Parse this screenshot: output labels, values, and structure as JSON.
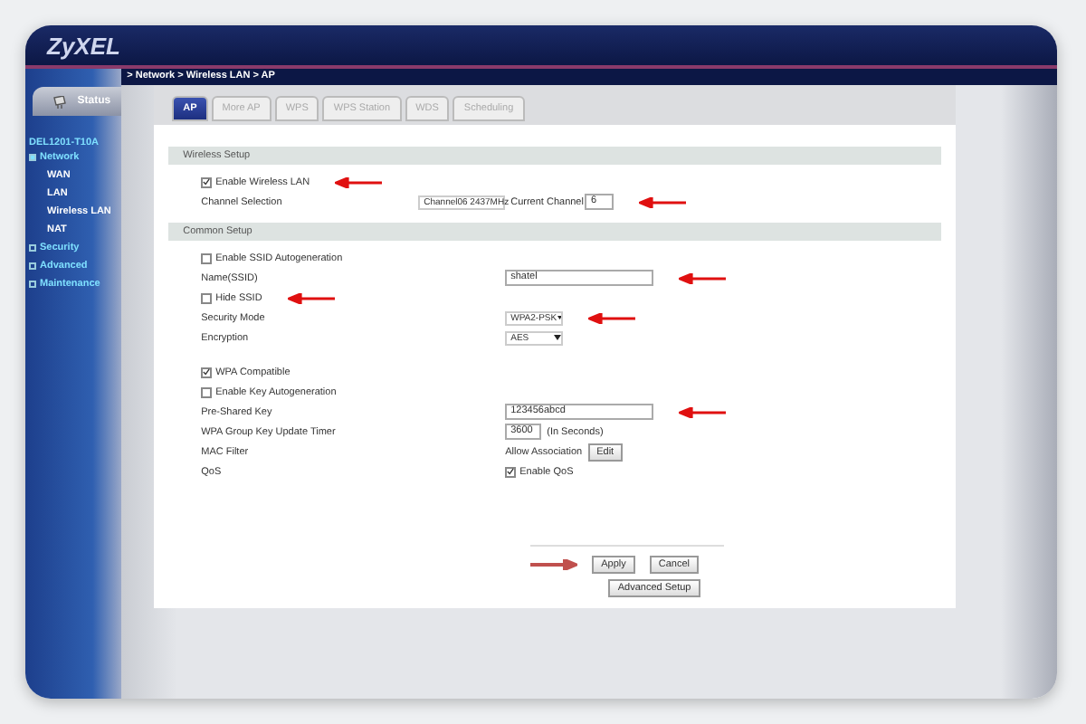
{
  "header": {
    "logo": "ZyXEL"
  },
  "sidebar": {
    "status_button": "Status",
    "device": "DEL1201-T10A",
    "items": [
      {
        "label": "Network",
        "expanded": true,
        "children": [
          {
            "label": "WAN"
          },
          {
            "label": "LAN"
          },
          {
            "label": "Wireless LAN"
          },
          {
            "label": "NAT"
          }
        ]
      },
      {
        "label": "Security",
        "expanded": false
      },
      {
        "label": "Advanced",
        "expanded": false
      },
      {
        "label": "Maintenance",
        "expanded": false
      }
    ]
  },
  "breadcrumb": "> Network > Wireless LAN > AP",
  "tabs": [
    {
      "label": "AP",
      "selected": true
    },
    {
      "label": "More AP",
      "selected": false
    },
    {
      "label": "WPS",
      "selected": false
    },
    {
      "label": "WPS Station",
      "selected": false
    },
    {
      "label": "WDS",
      "selected": false
    },
    {
      "label": "Scheduling",
      "selected": false
    }
  ],
  "wireless_setup": {
    "title": "Wireless Setup",
    "enable": {
      "label": "Enable Wireless LAN",
      "checked": true,
      "arrow": true
    },
    "channel": {
      "label": "Channel Selection",
      "select": "Channel06 2437MHz",
      "current_label": "Current Channel",
      "current_value": "6",
      "arrow": true
    }
  },
  "common_setup": {
    "title": "Common Setup",
    "rows": [
      {
        "kind": "checkbox",
        "label": "Enable SSID Autogeneration",
        "checked": false,
        "arrow": false
      },
      {
        "kind": "field",
        "label": "Name(SSID)",
        "value": "shatel",
        "arrow": true
      },
      {
        "kind": "checkbox",
        "label": "Hide SSID",
        "checked": false,
        "arrow": true
      },
      {
        "kind": "select",
        "label": "Security Mode",
        "value": "WPA2-PSK",
        "arrow": true
      },
      {
        "kind": "select",
        "label": "Encryption",
        "value": "AES",
        "arrow": false
      },
      {
        "kind": "checkbox",
        "label": "WPA Compatible",
        "checked": true,
        "arrow": false
      },
      {
        "kind": "checkbox",
        "label": "Enable Key Autogeneration",
        "checked": false,
        "arrow": false
      },
      {
        "kind": "field",
        "label": "Pre-Shared Key",
        "value": "123456abcd",
        "arrow": true
      },
      {
        "kind": "short_field",
        "label": "WPA Group Key Update Timer",
        "value": "3600",
        "suffix": "(In Seconds)",
        "arrow": false
      },
      {
        "kind": "button",
        "label": "MAC Filter",
        "text": "Allow Association",
        "button": "Edit",
        "arrow": false
      },
      {
        "kind": "check_right",
        "label": "QoS",
        "checkbox_label": "Enable QoS",
        "checked": true,
        "arrow": false
      }
    ]
  },
  "buttons": [
    {
      "label": "Apply",
      "arrow": true
    },
    {
      "label": "Cancel",
      "arrow": false
    }
  ],
  "advanced_button": "Advanced Setup"
}
